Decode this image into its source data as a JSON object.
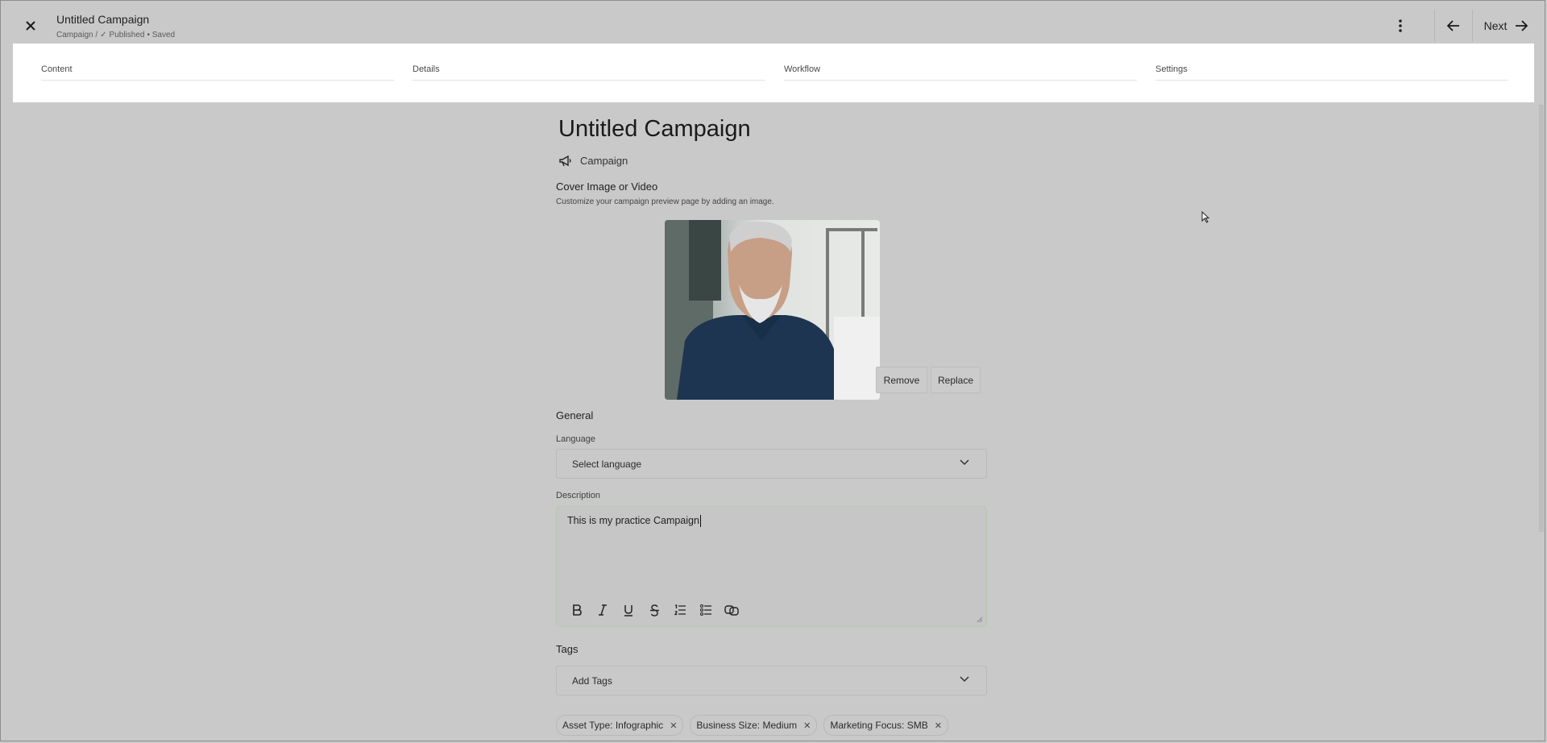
{
  "header": {
    "title": "Untitled Campaign",
    "breadcrumb_type": "Campaign /",
    "status": "Published",
    "saved": "• Saved",
    "next_label": "Next"
  },
  "tabs": [
    {
      "label": "Content"
    },
    {
      "label": "Details"
    },
    {
      "label": "Workflow"
    },
    {
      "label": "Settings"
    }
  ],
  "main": {
    "title": "Untitled Campaign",
    "type_label": "Campaign",
    "cover_label": "Cover Image or Video",
    "cover_help": "Customize your campaign preview page by adding an image.",
    "remove_label": "Remove",
    "replace_label": "Replace",
    "general_label": "General",
    "language_label": "Language",
    "language_value": "Select language",
    "description_label": "Description",
    "description_value": "This is my practice Campaign",
    "tags_label": "Tags",
    "tags_placeholder": "Add Tags",
    "chips": [
      {
        "label": "Asset Type: Infographic"
      },
      {
        "label": "Business Size: Medium"
      },
      {
        "label": "Marketing Focus: SMB"
      }
    ]
  },
  "toolbar_icons": [
    "bold-icon",
    "italic-icon",
    "underline-icon",
    "strikethrough-icon",
    "numbered-list-icon",
    "bullet-list-icon",
    "link-icon"
  ],
  "colors": {
    "overlay_background": "#c9c9c9",
    "tabs_panel": "#ffffff",
    "description_border": "#b6c9ae"
  }
}
